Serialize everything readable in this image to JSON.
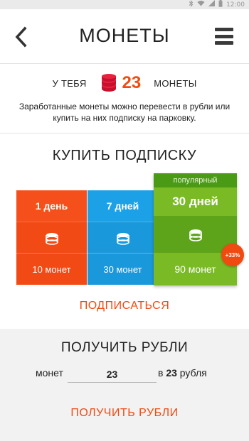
{
  "statusbar": {
    "time": "12:00",
    "icons": [
      "bluetooth-icon",
      "wifi-icon",
      "signal-icon",
      "battery-icon"
    ]
  },
  "header": {
    "title": "МОНЕТЫ",
    "back_icon": "chevron-left-icon",
    "menu_icon": "hamburger-menu-icon"
  },
  "balance": {
    "prefix": "У ТЕБЯ",
    "count": "23",
    "suffix": "МОНЕТЫ",
    "coin_icon": "coin-stack-icon",
    "description": "Заработанные монеты можно перевести в рубли или купить на них подписку на парковку."
  },
  "subscription": {
    "title": "КУПИТЬ ПОДПИСКУ",
    "plans": [
      {
        "name": "1 день",
        "price": "10 монет",
        "color": "#f24a14"
      },
      {
        "name": "7 дней",
        "price": "30 монет",
        "color": "#1a98dc"
      },
      {
        "name": "30 дней",
        "price": "90 монет",
        "color": "#7abb25",
        "badge_top": "популярный",
        "discount": "+33%"
      }
    ],
    "subscribe_label": "ПОДПИСАТЬСЯ"
  },
  "rubles": {
    "title": "ПОЛУЧИТЬ РУБЛИ",
    "input_prefix": "монет",
    "input_value": "23",
    "result_prefix": "в",
    "result_amount": "23",
    "result_suffix": "рубля",
    "button_label": "ПОЛУЧИТЬ РУБЛИ"
  },
  "colors": {
    "accent": "#f04a12",
    "blue": "#1a98dc",
    "green": "#7abb25"
  }
}
